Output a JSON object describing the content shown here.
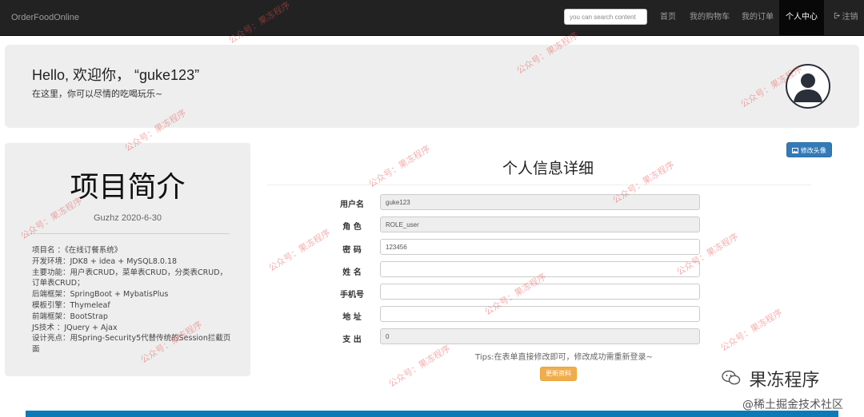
{
  "navbar": {
    "brand": "OrderFoodOnline",
    "search_placeholder": "you can search content",
    "links": {
      "home": "首页",
      "cart": "我的购物车",
      "orders": "我的订单",
      "profile": "个人中心",
      "logout": "注销"
    },
    "logout_icon": "sign-out-icon"
  },
  "jumbotron": {
    "greeting": "Hello, 欢迎你， “guke123”",
    "subtitle": "在这里，你可以尽情的吃喝玩乐~",
    "avatar_icon": "user-avatar-icon"
  },
  "intro": {
    "title": "项目简介",
    "author_date": "Guzhz    2020-6-30",
    "lines": [
      "项目名    ：《在线订餐系统》",
      "开发环境：JDK8 + idea + MySQL8.0.18",
      "主要功能：用户表CRUD，菜单表CRUD，分类表CRUD，订单表CRUD；",
      "后端框架：SpringBoot + MybatisPlus",
      "模板引擎：Thymeleaf",
      "前端框架：BootStrap",
      "JS技术    ：JQuery + Ajax",
      "设计亮点：用Spring-Security5代替传统的Session拦截页面"
    ]
  },
  "profile": {
    "change_avatar_label": "修改头像",
    "change_avatar_icon": "image-icon",
    "title": "个人信息详细",
    "fields": {
      "username": {
        "label": "用户名",
        "value": "guke123"
      },
      "role": {
        "label": "角  色",
        "value": "ROLE_user"
      },
      "password": {
        "label": "密  码",
        "value": "123456"
      },
      "name": {
        "label": "姓  名",
        "value": ""
      },
      "phone": {
        "label": "手机号",
        "value": ""
      },
      "address": {
        "label": "地  址",
        "value": ""
      },
      "expense": {
        "label": "支  出",
        "value": "0"
      }
    },
    "tips": "Tips:在表单直接修改即可，修改成功需重新登录~",
    "update_label": "更新资料"
  },
  "watermark": {
    "text": "公众号：果冻程序",
    "brand": "果冻程序",
    "brand_icon": "wechat-icon",
    "site": "@稀土掘金技术社区"
  },
  "colors": {
    "navbar_bg": "#222222",
    "primary": "#337ab7",
    "warning": "#f0ad4e",
    "bottom_bar": "#0a7ab8"
  }
}
